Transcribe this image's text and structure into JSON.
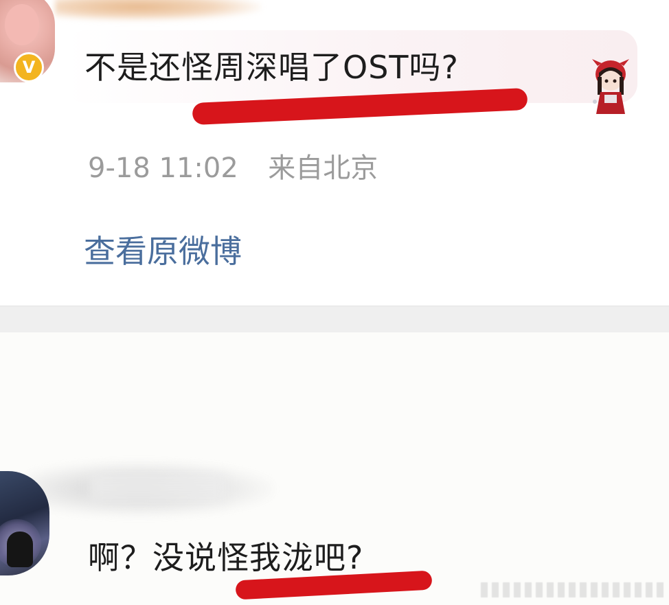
{
  "comment": {
    "text": "不是还怪周深唱了OST吗?",
    "timestamp": "9-18 11:02",
    "location": "来自北京",
    "verified_badge": "V",
    "view_original_link": "查看原微博"
  },
  "reply": {
    "text": "啊？没说怪我泷吧?"
  },
  "colors": {
    "link": "#4a6e9d",
    "underline": "#d7151b",
    "timestamp": "#9b9b9b",
    "text": "#1d1d1d",
    "badge": "#f3b41f"
  },
  "icons": {
    "verified": "verified-v-badge",
    "sticker": "chibi-girl-sticker"
  }
}
